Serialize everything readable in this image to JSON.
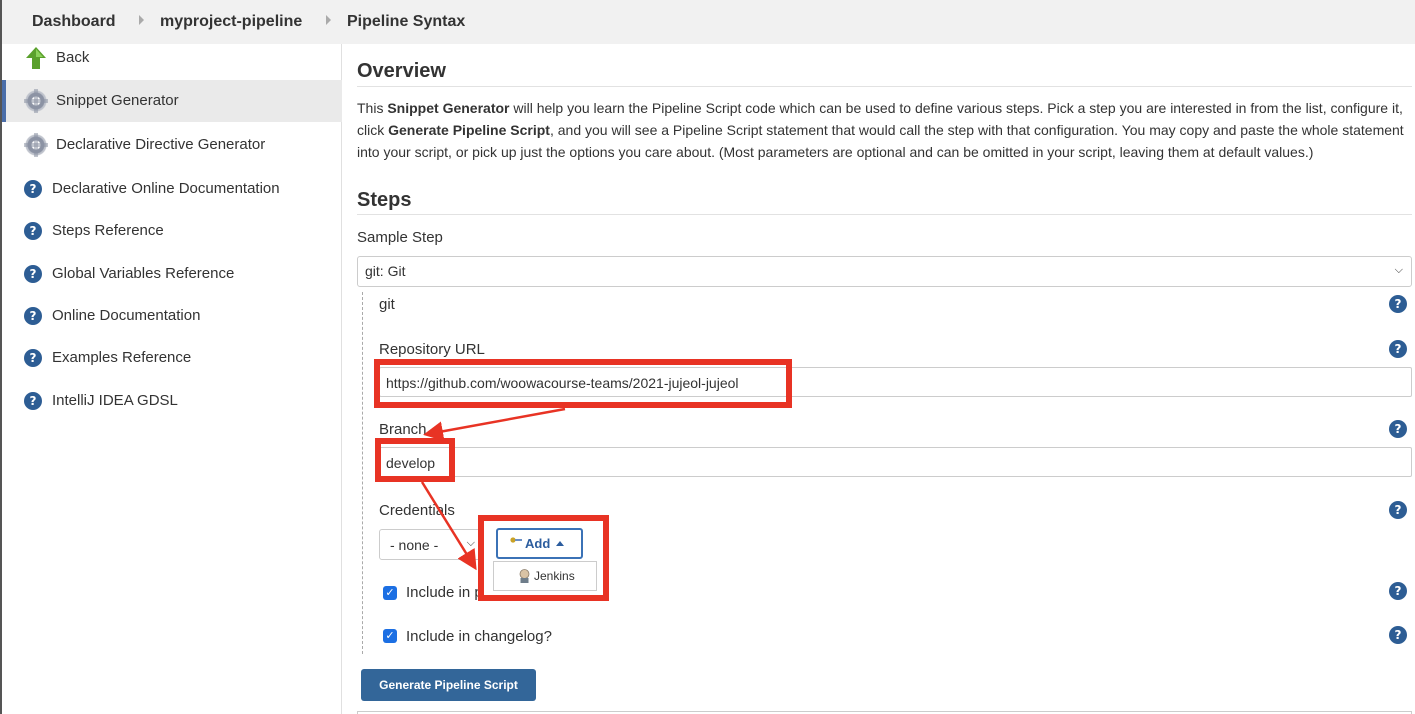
{
  "breadcrumb": {
    "items": [
      "Dashboard",
      "myproject-pipeline",
      "Pipeline Syntax"
    ]
  },
  "sidebar": {
    "items": [
      {
        "label": "Back",
        "icon": "up-arrow-icon"
      },
      {
        "label": "Snippet Generator",
        "icon": "gear-icon"
      },
      {
        "label": "Declarative Directive Generator",
        "icon": "gear-icon"
      },
      {
        "label": "Declarative Online Documentation",
        "icon": "help-icon"
      },
      {
        "label": "Steps Reference",
        "icon": "help-icon"
      },
      {
        "label": "Global Variables Reference",
        "icon": "help-icon"
      },
      {
        "label": "Online Documentation",
        "icon": "help-icon"
      },
      {
        "label": "Examples Reference",
        "icon": "help-icon"
      },
      {
        "label": "IntelliJ IDEA GDSL",
        "icon": "help-icon"
      }
    ]
  },
  "overview": {
    "heading": "Overview",
    "text_1": "This ",
    "bold_1": "Snippet Generator",
    "text_2": " will help you learn the Pipeline Script code which can be used to define various steps. Pick a step you are interested in from the list, configure it, click ",
    "bold_2": "Generate Pipeline Script",
    "text_3": ", and you will see a Pipeline Script statement that would call the step with that configuration. You may copy and paste the whole statement into your script, or pick up just the options you care about. (Most parameters are optional and can be omitted in your script, leaving them at default values.)"
  },
  "steps": {
    "heading": "Steps",
    "sample_step_label": "Sample Step",
    "sample_step_value": "git: Git",
    "step_name": "git",
    "repo_label": "Repository URL",
    "repo_value": "https://github.com/woowacourse-teams/2021-jujeol-jujeol",
    "branch_label": "Branch",
    "branch_value": "develop",
    "credentials_label": "Credentials",
    "credentials_value": "- none -",
    "add_label": "Add",
    "dropdown_item": "Jenkins",
    "include_polling_label": "Include in p",
    "include_changelog_label": "Include in changelog?",
    "generate_label": "Generate Pipeline Script"
  },
  "colors": {
    "highlight": "#e83324",
    "help_icon": "#2d5d94",
    "primary_button": "#336699",
    "checkbox": "#1c6fe3"
  }
}
